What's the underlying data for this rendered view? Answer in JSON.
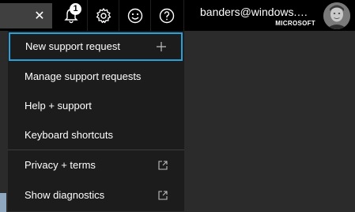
{
  "topbar": {
    "search_clear_icon": "close-icon",
    "notifications": {
      "icon": "bell-icon",
      "count": "1"
    },
    "settings_icon": "gear-icon",
    "feedback_icon": "smiley-icon",
    "help_icon": "question-icon",
    "account": {
      "email": "banders@windows.mi...",
      "tenant": "MICROSOFT"
    }
  },
  "menu": {
    "items": [
      {
        "label": "New support request",
        "icon": "plus-icon"
      },
      {
        "label": "Manage support requests"
      },
      {
        "label": "Help + support"
      },
      {
        "label": "Keyboard shortcuts"
      },
      {
        "label": "Privacy + terms",
        "icon": "external-link-icon"
      },
      {
        "label": "Show diagnostics",
        "icon": "external-link-icon"
      }
    ]
  },
  "colors": {
    "topbar_background": "#000000",
    "menu_background": "#1c1c1c",
    "focus_border": "#2a9fd8",
    "page_background": "#2b2b2b"
  }
}
